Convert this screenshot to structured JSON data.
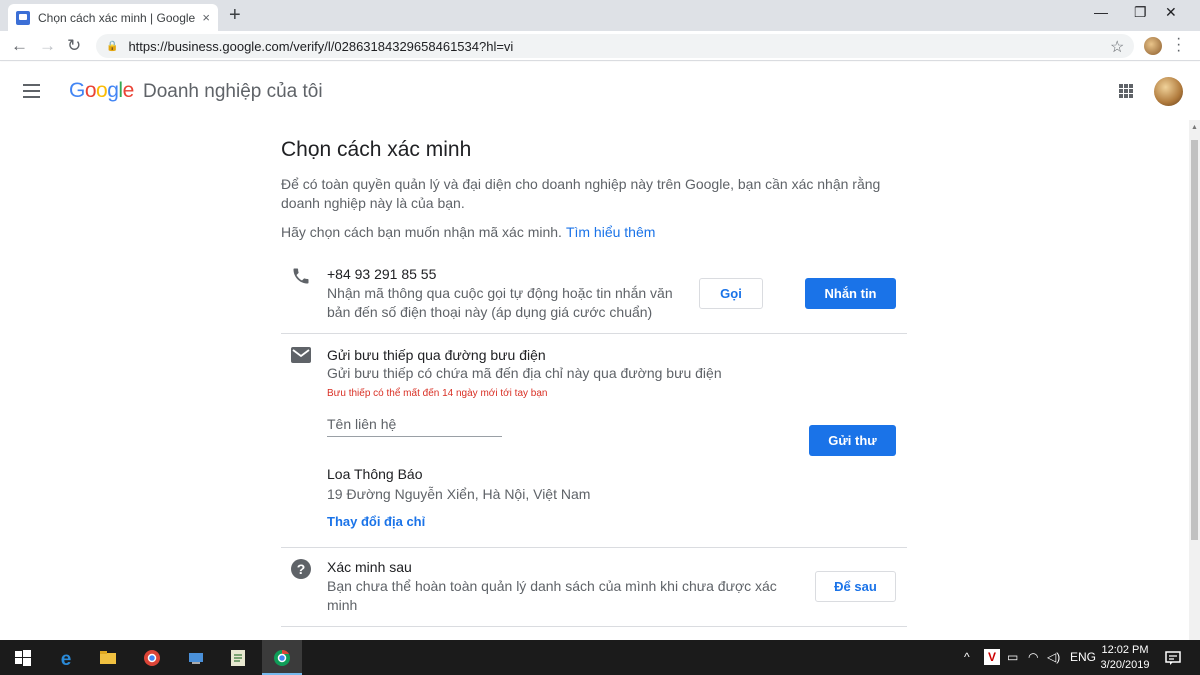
{
  "browser": {
    "tab_title": "Chọn cách xác minh | Google Do",
    "tab_close": "×",
    "new_tab": "+",
    "url": "https://business.google.com/verify/l/02863184329658461534?hl=vi",
    "win_min": "—",
    "win_max": "❐",
    "win_close": "✕"
  },
  "app": {
    "logo": [
      "G",
      "o",
      "o",
      "g",
      "l",
      "e"
    ],
    "title": "Doanh nghiệp của tôi"
  },
  "page": {
    "heading": "Chọn cách xác minh",
    "description": "Để có toàn quyền quản lý và đại diện cho doanh nghiệp này trên Google, bạn cần xác nhận rằng doanh nghiệp này là của bạn.",
    "choose_text": "Hãy chọn cách bạn muốn nhận mã xác minh.",
    "learn_more": "Tìm hiểu thêm"
  },
  "phone_option": {
    "number": "+84 93 291 85 55",
    "description": "Nhận mã thông qua cuộc gọi tự động hoặc tin nhắn văn bản đến số điện thoại này (áp dụng giá cước chuẩn)",
    "call_label": "Gọi",
    "sms_label": "Nhắn tin"
  },
  "mail_option": {
    "title": "Gửi bưu thiếp qua đường bưu điện",
    "description": "Gửi bưu thiếp có chứa mã đến địa chỉ này qua đường bưu điện",
    "warning": "Bưu thiếp có thể mất đến 14 ngày mới tới tay bạn",
    "contact_placeholder": "Tên liên hệ",
    "send_label": "Gửi thư",
    "business_name": "Loa Thông Báo",
    "address": "19 Đường Nguyễn Xiển, Hà Nội, Việt Nam",
    "change_address": "Thay đổi địa chỉ"
  },
  "later_option": {
    "title": "Xác minh sau",
    "description": "Bạn chưa thể hoàn toàn quản lý danh sách của mình khi chưa được xác minh",
    "later_label": "Để sau"
  },
  "taskbar": {
    "lang": "ENG",
    "time": "12:02 PM",
    "date": "3/20/2019"
  },
  "colors": {
    "primary": "#1a73e8",
    "warning": "#d93025",
    "taskbar": "#1b1b1b"
  }
}
